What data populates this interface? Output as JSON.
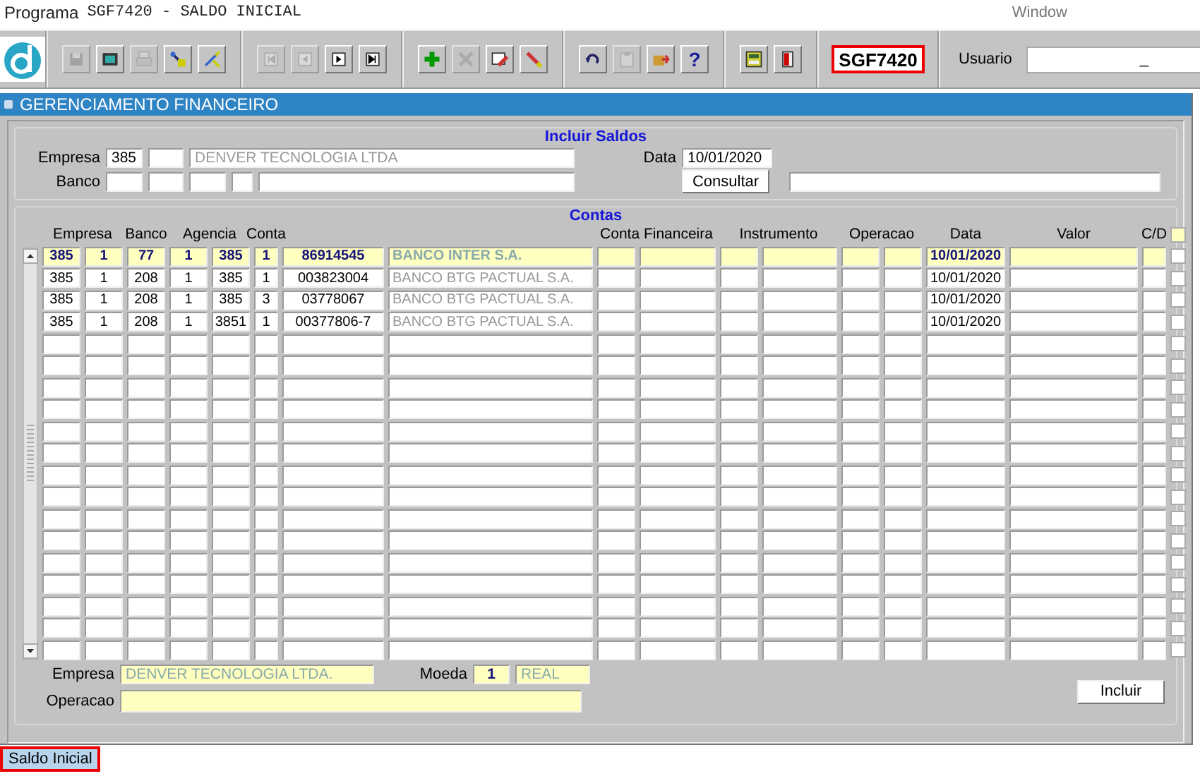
{
  "window": {
    "program_label": "Programa",
    "title": "SGF7420 - SALDO INICIAL",
    "menu": "Window"
  },
  "toolbar": {
    "groups": [
      [
        {
          "kind": "save",
          "disabled": true
        },
        {
          "kind": "screen",
          "disabled": false
        },
        {
          "kind": "print",
          "disabled": true
        },
        {
          "kind": "query",
          "disabled": false
        },
        {
          "kind": "wand",
          "disabled": false
        }
      ],
      [
        {
          "kind": "first",
          "disabled": true
        },
        {
          "kind": "prev",
          "disabled": true
        },
        {
          "kind": "next",
          "disabled": false
        },
        {
          "kind": "last",
          "disabled": false
        }
      ],
      [
        {
          "kind": "add",
          "disabled": false
        },
        {
          "kind": "delete",
          "disabled": true
        },
        {
          "kind": "record",
          "disabled": false
        },
        {
          "kind": "edit",
          "disabled": false
        }
      ],
      [
        {
          "kind": "undo",
          "disabled": false
        },
        {
          "kind": "paste",
          "disabled": true
        },
        {
          "kind": "export",
          "disabled": false
        },
        {
          "kind": "help",
          "disabled": false,
          "label": "?"
        }
      ],
      [
        {
          "kind": "calculator",
          "disabled": false
        },
        {
          "kind": "exit",
          "disabled": false
        }
      ]
    ],
    "program_code": "SGF7420",
    "user_label": "Usuario",
    "user_value": "_"
  },
  "section": {
    "title": "GERENCIAMENTO FINANCEIRO"
  },
  "incluir_saldos": {
    "title": "Incluir Saldos",
    "empresa_label": "Empresa",
    "empresa_code": "385",
    "empresa_name": "DENVER TECNOLOGIA LTDA",
    "banco_label": "Banco",
    "data_label": "Data",
    "data_value": "10/01/2020",
    "consultar_button": "Consultar"
  },
  "contas": {
    "title": "Contas",
    "columns": [
      "Empresa",
      "Banco",
      "Agencia",
      "Conta",
      "Conta Financeira",
      "Instrumento",
      "Operacao",
      "Data",
      "Valor",
      "C/D"
    ],
    "header_checked": false,
    "rows": [
      {
        "selected": true,
        "checked": false,
        "cells": [
          "385",
          "1",
          "77",
          "1",
          "385",
          "1",
          "86914545",
          "BANCO INTER S.A."
        ],
        "data": "10/01/2020"
      },
      {
        "selected": false,
        "checked": false,
        "cells": [
          "385",
          "1",
          "208",
          "1",
          "385",
          "1",
          "003823004",
          "BANCO BTG PACTUAL S.A."
        ],
        "data": "10/01/2020"
      },
      {
        "selected": false,
        "checked": false,
        "cells": [
          "385",
          "1",
          "208",
          "1",
          "385",
          "3",
          "03778067",
          "BANCO BTG PACTUAL S.A."
        ],
        "data": "10/01/2020"
      },
      {
        "selected": false,
        "checked": false,
        "cells": [
          "385",
          "1",
          "208",
          "1",
          "3851",
          "1",
          "00377806-7",
          "BANCO BTG PACTUAL S.A."
        ],
        "data": "10/01/2020"
      },
      {
        "selected": false,
        "checked": false
      },
      {
        "selected": false,
        "checked": false
      },
      {
        "selected": false,
        "checked": false
      },
      {
        "selected": false,
        "checked": false
      },
      {
        "selected": false,
        "checked": false
      },
      {
        "selected": false,
        "checked": false
      },
      {
        "selected": false,
        "checked": false
      },
      {
        "selected": false,
        "checked": false
      },
      {
        "selected": false,
        "checked": false
      },
      {
        "selected": false,
        "checked": false
      },
      {
        "selected": false,
        "checked": false
      },
      {
        "selected": false,
        "checked": false
      },
      {
        "selected": false,
        "checked": false
      },
      {
        "selected": false,
        "checked": false
      },
      {
        "selected": false,
        "checked": false
      }
    ]
  },
  "footer": {
    "empresa_label": "Empresa",
    "empresa_value": "DENVER TECNOLOGIA LTDA.",
    "moeda_label": "Moeda",
    "moeda_code": "1",
    "moeda_name": "REAL",
    "operacao_label": "Operacao",
    "incluir_button": "Incluir"
  },
  "status_tab": {
    "label": "Saldo Inicial"
  }
}
